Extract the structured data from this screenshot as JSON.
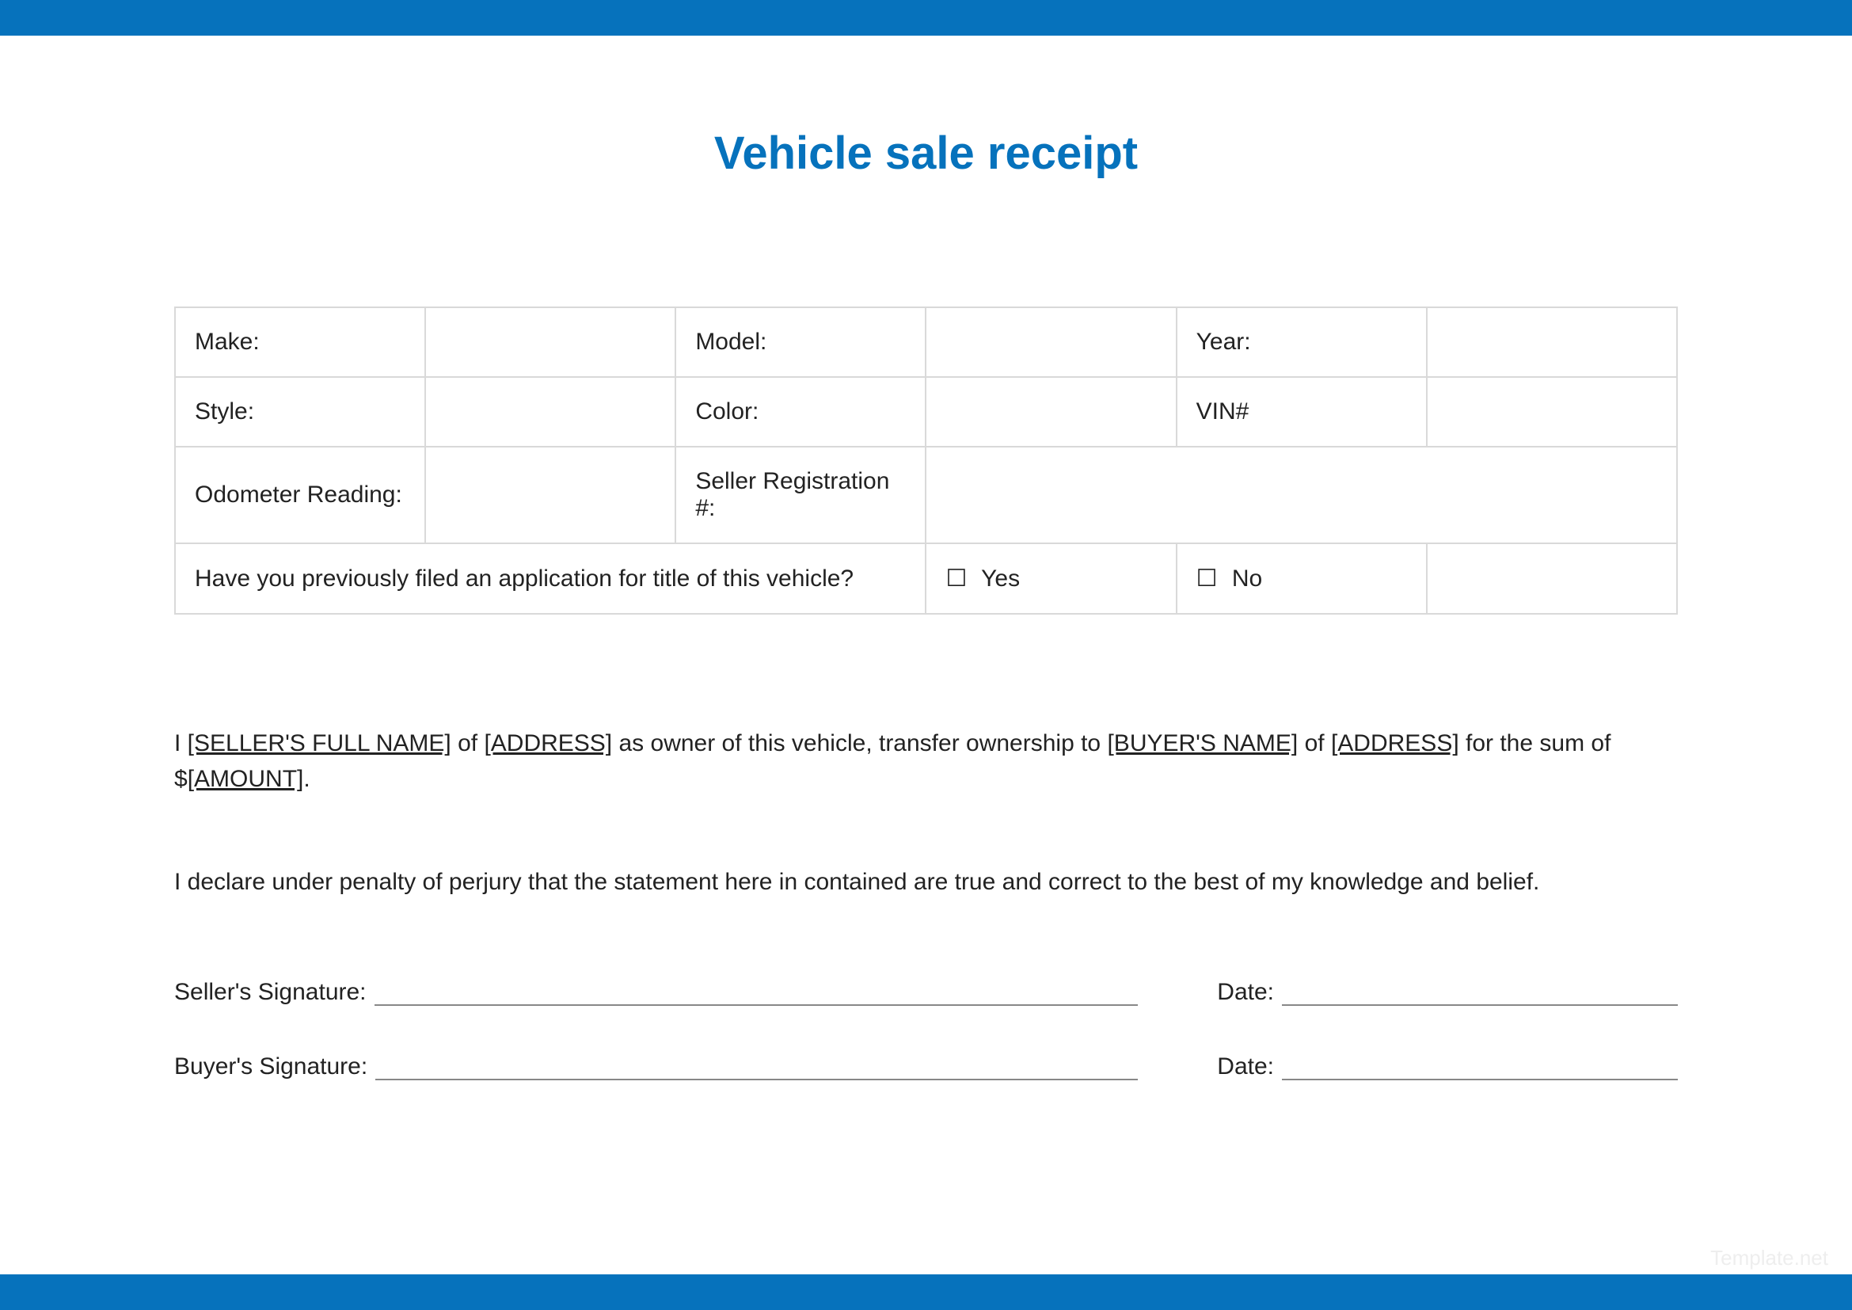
{
  "title": "Vehicle sale receipt",
  "fields": {
    "make": "Make:",
    "model": "Model:",
    "year": "Year:",
    "style": "Style:",
    "color": "Color:",
    "vin": "VIN#",
    "odometer": "Odometer Reading:",
    "sellerReg": "Seller Registration #:",
    "titleQuestion": "Have you previously filed an application for title of this vehicle?",
    "yes": "Yes",
    "no": "No"
  },
  "transfer": {
    "part1": "I ",
    "sellerName": "[SELLER'S FULL NAME]",
    "part2": " of ",
    "sellerAddress": "[ADDRESS]",
    "part3": " as owner of this vehicle, transfer ownership to ",
    "buyerName": "[BUYER'S NAME]",
    "part4": " of ",
    "buyerAddress": "[ADDRESS]",
    "part5": " for the sum of $",
    "amount": "[AMOUNT]",
    "part6": "."
  },
  "declaration": "I declare under penalty of perjury that the statement here in contained are true and correct to the best of my knowledge and belief.",
  "signatures": {
    "sellerLabel": "Seller's Signature:",
    "buyerLabel": "Buyer's Signature:",
    "dateLabel": "Date:"
  },
  "watermark": "Template.net"
}
